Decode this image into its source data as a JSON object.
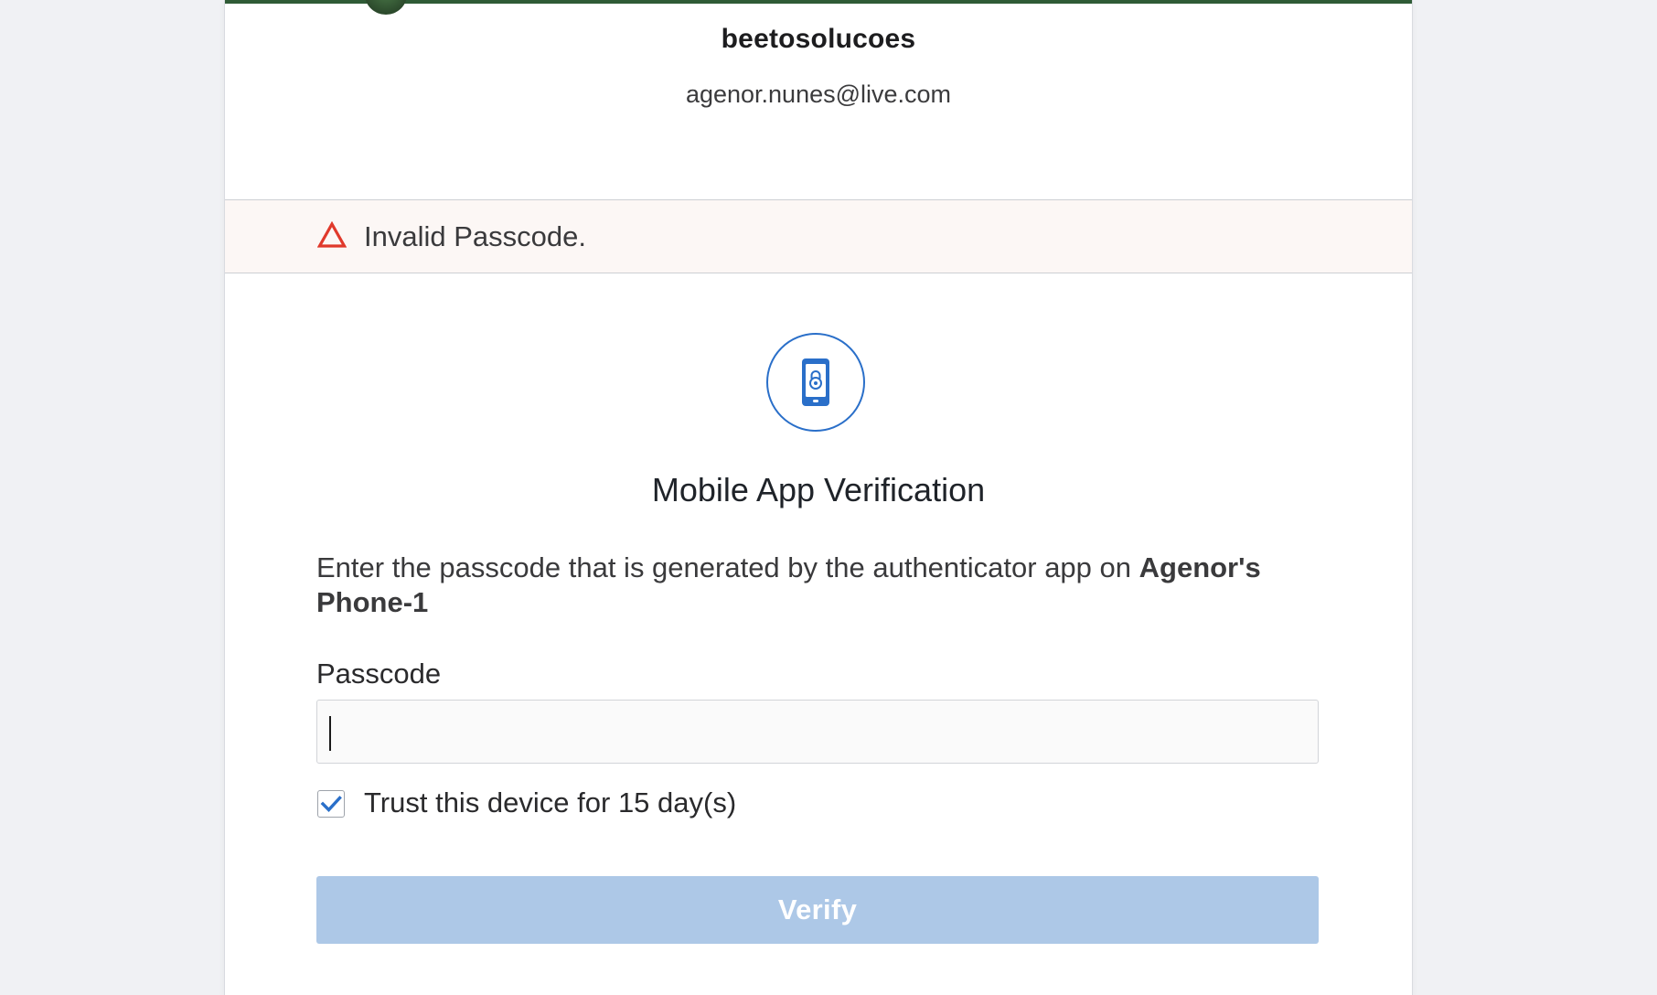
{
  "org": {
    "name": "beetosolucoes"
  },
  "user": {
    "email": "agenor.nunes@live.com"
  },
  "alert": {
    "text": "Invalid Passcode.",
    "icon": "warning-triangle-icon",
    "color": "#e0392b"
  },
  "factor": {
    "icon": "mobile-lock-icon",
    "title": "Mobile App Verification",
    "instructions_prefix": "Enter the passcode that is generated by the authenticator app on ",
    "device_name": "Agenor's Phone-1",
    "accent_color": "#2a6fc9"
  },
  "passcode": {
    "label": "Passcode",
    "value": "",
    "placeholder": ""
  },
  "trust": {
    "label": "Trust this device for 15 day(s)",
    "checked": true
  },
  "verify": {
    "label": "Verify",
    "disabled": true,
    "color": "#adc8e7"
  }
}
